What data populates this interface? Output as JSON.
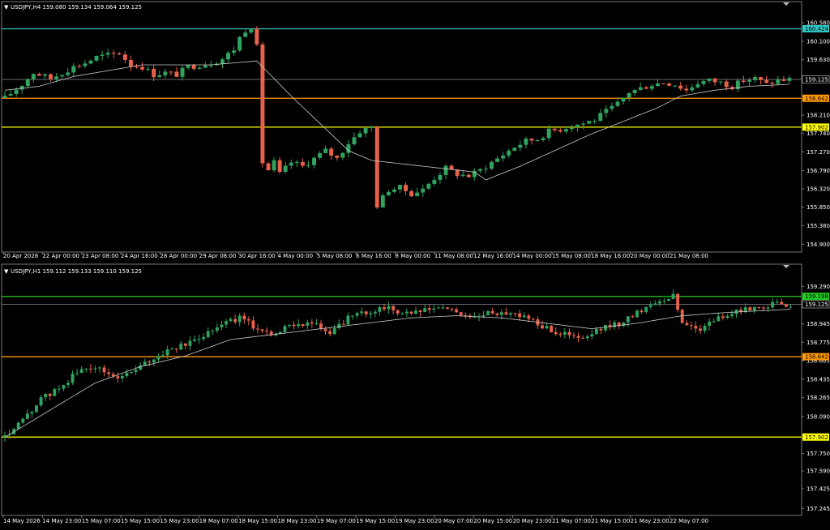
{
  "colors": {
    "background": "#000000",
    "frame": "#7a7a7a",
    "bull": "#2fa35f",
    "bear": "#e8614b",
    "ma": "#c8c8c8",
    "text": "#ffffff",
    "current": "#6a6a6a"
  },
  "panes": [
    {
      "header": "USDJPY,H4  159.080 159.134 159.064 159.125",
      "chart_data": {
        "type": "candlestick",
        "symbol": "USDJPY",
        "timeframe": "H4",
        "ylim": [
          154.7,
          160.85
        ],
        "y_ticks": [
          "160.580",
          "160.100",
          "159.630",
          "159.125",
          "158.642",
          "158.210",
          "157.902",
          "157.740",
          "157.270",
          "156.790",
          "156.320",
          "155.850",
          "155.380",
          "154.900"
        ],
        "x_ticks": [
          "20 Apr 2026",
          "22 Apr 00:00",
          "23 Apr 08:00",
          "24 Apr 16:00",
          "28 Apr 00:00",
          "29 Apr 08:00",
          "30 Apr 16:00",
          "4 May 00:00",
          "5 May 08:00",
          "6 May 16:00",
          "8 May 00:00",
          "11 May 08:00",
          "12 May 16:00",
          "14 May 00:00",
          "15 May 08:00",
          "18 May 16:00",
          "20 May 00:00",
          "21 May 08:00"
        ],
        "levels": [
          {
            "value": 160.424,
            "label": "160.424",
            "color": "#2ec4c4"
          },
          {
            "value": 158.642,
            "label": "158.642",
            "color": "#ff9900"
          },
          {
            "value": 157.902,
            "label": "157.902",
            "color": "#ffff00"
          }
        ],
        "current": {
          "value": 159.125,
          "label": "159.125"
        },
        "close_path": [
          [
            0,
            158.65
          ],
          [
            3,
            159.0
          ],
          [
            5,
            159.3
          ],
          [
            8,
            159.15
          ],
          [
            10,
            159.3
          ],
          [
            12,
            159.45
          ],
          [
            14,
            159.55
          ],
          [
            16,
            159.7
          ],
          [
            18,
            159.75
          ],
          [
            20,
            159.8
          ],
          [
            22,
            159.5
          ],
          [
            24,
            159.45
          ],
          [
            26,
            159.25
          ],
          [
            28,
            159.3
          ],
          [
            30,
            159.25
          ],
          [
            32,
            159.45
          ],
          [
            34,
            159.5
          ],
          [
            36,
            159.55
          ],
          [
            38,
            159.65
          ],
          [
            40,
            159.9
          ],
          [
            41,
            160.2
          ],
          [
            42,
            160.4
          ],
          [
            43,
            160.5
          ],
          [
            44,
            159.95
          ],
          [
            45,
            157.0
          ],
          [
            46,
            156.8
          ],
          [
            47,
            157.0
          ],
          [
            48,
            156.7
          ],
          [
            50,
            157.0
          ],
          [
            52,
            156.9
          ],
          [
            54,
            157.1
          ],
          [
            56,
            157.3
          ],
          [
            58,
            157.1
          ],
          [
            60,
            157.5
          ],
          [
            62,
            157.8
          ],
          [
            64,
            157.9
          ],
          [
            65,
            155.9
          ],
          [
            67,
            156.3
          ],
          [
            69,
            156.35
          ],
          [
            71,
            156.2
          ],
          [
            73,
            156.3
          ],
          [
            75,
            156.6
          ],
          [
            77,
            156.85
          ],
          [
            79,
            156.7
          ],
          [
            81,
            156.65
          ],
          [
            83,
            156.8
          ],
          [
            85,
            157.0
          ],
          [
            87,
            157.2
          ],
          [
            89,
            157.4
          ],
          [
            91,
            157.55
          ],
          [
            93,
            157.6
          ],
          [
            95,
            157.8
          ],
          [
            97,
            157.85
          ],
          [
            99,
            157.95
          ],
          [
            101,
            158.0
          ],
          [
            103,
            158.1
          ],
          [
            105,
            158.3
          ],
          [
            107,
            158.5
          ],
          [
            109,
            158.8
          ],
          [
            111,
            158.9
          ],
          [
            113,
            159.0
          ],
          [
            115,
            159.05
          ],
          [
            117,
            159.0
          ],
          [
            119,
            158.85
          ],
          [
            121,
            159.05
          ],
          [
            123,
            159.1
          ],
          [
            125,
            159.05
          ],
          [
            127,
            158.95
          ],
          [
            129,
            159.1
          ],
          [
            131,
            159.15
          ],
          [
            133,
            159.0
          ],
          [
            135,
            159.1
          ],
          [
            137,
            159.125
          ]
        ],
        "ma_path": [
          [
            0,
            158.85
          ],
          [
            6,
            158.95
          ],
          [
            12,
            159.2
          ],
          [
            18,
            159.35
          ],
          [
            24,
            159.5
          ],
          [
            30,
            159.5
          ],
          [
            36,
            159.5
          ],
          [
            40,
            159.55
          ],
          [
            44,
            159.6
          ],
          [
            46,
            159.3
          ],
          [
            50,
            158.7
          ],
          [
            55,
            158.0
          ],
          [
            60,
            157.3
          ],
          [
            64,
            157.05
          ],
          [
            70,
            156.95
          ],
          [
            76,
            156.85
          ],
          [
            82,
            156.75
          ],
          [
            84,
            156.55
          ],
          [
            90,
            156.9
          ],
          [
            96,
            157.3
          ],
          [
            102,
            157.7
          ],
          [
            108,
            158.05
          ],
          [
            114,
            158.4
          ],
          [
            118,
            158.7
          ],
          [
            124,
            158.85
          ],
          [
            130,
            158.95
          ],
          [
            137,
            159.0
          ]
        ]
      }
    },
    {
      "header": "USDJPY,H1  159.112 159.133 159.110 159.125",
      "chart_data": {
        "type": "candlestick",
        "symbol": "USDJPY",
        "timeframe": "H1",
        "ylim": [
          157.18,
          159.39
        ],
        "y_ticks": [
          "159.290",
          "159.125",
          "158.945",
          "158.775",
          "158.642",
          "158.605",
          "158.435",
          "158.265",
          "158.090",
          "157.902",
          "157.750",
          "157.590",
          "157.425",
          "157.245"
        ],
        "x_ticks": [
          "14 May 2026",
          "14 May 23:00",
          "15 May 07:00",
          "15 May 15:00",
          "15 May 23:00",
          "18 May 07:00",
          "18 May 15:00",
          "18 May 23:00",
          "19 May 07:00",
          "19 May 15:00",
          "19 May 23:00",
          "20 May 07:00",
          "20 May 15:00",
          "20 May 23:00",
          "21 May 07:00",
          "21 May 15:00",
          "21 May 23:00",
          "22 May 07:00"
        ],
        "levels": [
          {
            "value": 159.198,
            "label": "159.198",
            "color": "#22cc22"
          },
          {
            "value": 158.642,
            "label": "158.642",
            "color": "#ff9900"
          },
          {
            "value": 157.902,
            "label": "157.902",
            "color": "#ffff00"
          }
        ],
        "current": {
          "value": 159.125,
          "label": "159.125"
        },
        "close_path": [
          [
            0,
            157.9
          ],
          [
            4,
            158.05
          ],
          [
            8,
            158.25
          ],
          [
            12,
            158.35
          ],
          [
            16,
            158.5
          ],
          [
            20,
            158.55
          ],
          [
            24,
            158.45
          ],
          [
            28,
            158.5
          ],
          [
            32,
            158.6
          ],
          [
            36,
            158.7
          ],
          [
            40,
            158.75
          ],
          [
            44,
            158.85
          ],
          [
            48,
            158.95
          ],
          [
            52,
            159.0
          ],
          [
            56,
            158.9
          ],
          [
            60,
            158.85
          ],
          [
            64,
            158.95
          ],
          [
            68,
            158.95
          ],
          [
            72,
            158.85
          ],
          [
            76,
            159.0
          ],
          [
            80,
            159.05
          ],
          [
            84,
            159.1
          ],
          [
            88,
            159.05
          ],
          [
            92,
            159.05
          ],
          [
            96,
            159.1
          ],
          [
            100,
            159.05
          ],
          [
            104,
            159.0
          ],
          [
            108,
            159.05
          ],
          [
            112,
            159.05
          ],
          [
            116,
            159.0
          ],
          [
            120,
            158.9
          ],
          [
            124,
            158.85
          ],
          [
            128,
            158.8
          ],
          [
            132,
            158.9
          ],
          [
            136,
            158.95
          ],
          [
            140,
            159.05
          ],
          [
            144,
            159.15
          ],
          [
            148,
            159.2
          ],
          [
            150,
            158.95
          ],
          [
            154,
            158.9
          ],
          [
            158,
            159.0
          ],
          [
            162,
            159.05
          ],
          [
            166,
            159.1
          ],
          [
            170,
            159.12
          ],
          [
            174,
            159.125
          ]
        ],
        "ma_path": [
          [
            0,
            157.9
          ],
          [
            10,
            158.15
          ],
          [
            20,
            158.4
          ],
          [
            30,
            158.55
          ],
          [
            40,
            158.65
          ],
          [
            50,
            158.8
          ],
          [
            60,
            158.85
          ],
          [
            70,
            158.9
          ],
          [
            80,
            158.95
          ],
          [
            90,
            159.0
          ],
          [
            100,
            159.02
          ],
          [
            110,
            159.0
          ],
          [
            120,
            158.95
          ],
          [
            130,
            158.9
          ],
          [
            140,
            158.95
          ],
          [
            150,
            159.02
          ],
          [
            160,
            159.05
          ],
          [
            174,
            159.08
          ]
        ]
      }
    }
  ]
}
